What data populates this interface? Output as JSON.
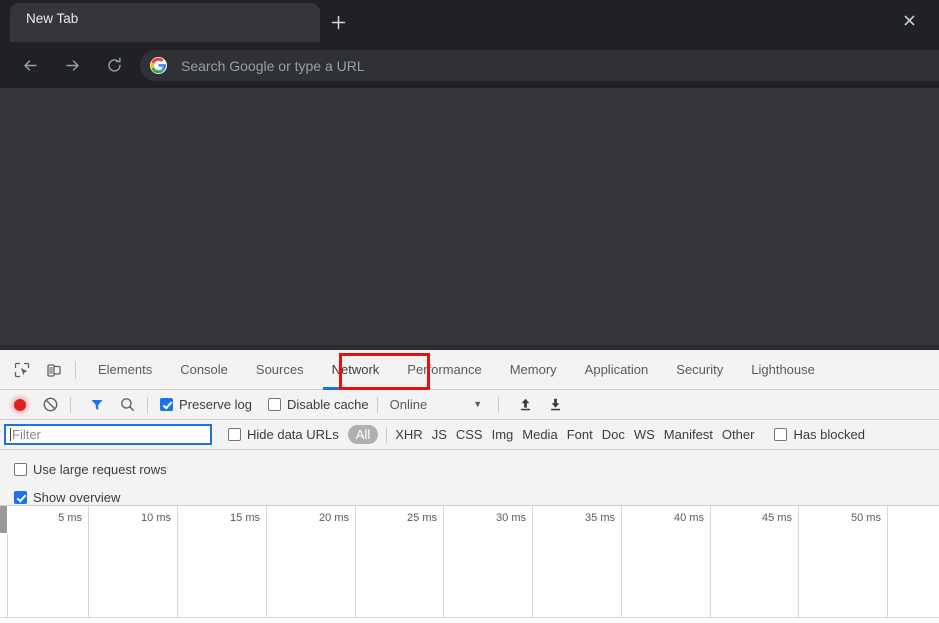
{
  "browser": {
    "tab": {
      "title": "New Tab",
      "close_icon": "close-icon"
    },
    "new_tab_button": "+",
    "nav": {
      "back_icon": "back-arrow-icon",
      "forward_icon": "forward-arrow-icon",
      "reload_icon": "reload-icon"
    },
    "omnibox": {
      "placeholder": "Search Google or type a URL",
      "value": "",
      "icon": "google-logo-icon"
    }
  },
  "devtools": {
    "inspect_icon": "inspect-element-icon",
    "device_icon": "device-toolbar-icon",
    "tabs": [
      {
        "label": "Elements",
        "active": false
      },
      {
        "label": "Console",
        "active": false
      },
      {
        "label": "Sources",
        "active": false
      },
      {
        "label": "Network",
        "active": true
      },
      {
        "label": "Performance",
        "active": false
      },
      {
        "label": "Memory",
        "active": false
      },
      {
        "label": "Application",
        "active": false
      },
      {
        "label": "Security",
        "active": false
      },
      {
        "label": "Lighthouse",
        "active": false
      }
    ],
    "annotation": {
      "target": "Network",
      "color": "#e3110f"
    },
    "toolbar": {
      "record_icon": "record-icon",
      "clear_icon": "clear-icon",
      "filter_icon": "filter-funnel-icon",
      "search_icon": "search-icon",
      "preserve_log": {
        "label": "Preserve log",
        "checked": true
      },
      "disable_cache": {
        "label": "Disable cache",
        "checked": false
      },
      "throttle": {
        "value": "Online",
        "caret": "▼"
      },
      "import_icon": "import-har-icon",
      "export_icon": "export-har-icon"
    },
    "filterbar": {
      "filter_input": {
        "placeholder": "Filter",
        "value": ""
      },
      "hide_data_urls": {
        "label": "Hide data URLs",
        "checked": false
      },
      "types": [
        {
          "label": "All",
          "selected": true
        },
        {
          "label": "XHR",
          "selected": false
        },
        {
          "label": "JS",
          "selected": false
        },
        {
          "label": "CSS",
          "selected": false
        },
        {
          "label": "Img",
          "selected": false
        },
        {
          "label": "Media",
          "selected": false
        },
        {
          "label": "Font",
          "selected": false
        },
        {
          "label": "Doc",
          "selected": false
        },
        {
          "label": "WS",
          "selected": false
        },
        {
          "label": "Manifest",
          "selected": false
        },
        {
          "label": "Other",
          "selected": false
        }
      ],
      "has_blocked": {
        "label": "Has blocked",
        "checked": false
      }
    },
    "options": {
      "use_large_request_rows": {
        "label": "Use large request rows",
        "checked": false
      },
      "show_overview": {
        "label": "Show overview",
        "checked": true
      }
    },
    "overview": {
      "ticks": [
        "5 ms",
        "10 ms",
        "15 ms",
        "20 ms",
        "25 ms",
        "30 ms",
        "35 ms",
        "40 ms",
        "45 ms",
        "50 ms"
      ],
      "empty": true
    }
  },
  "colors": {
    "chrome_dark": "#202124",
    "viewport": "#35363a",
    "devtools_bg": "#f3f3f3",
    "accent_blue": "#1a73e8",
    "annotation_red": "#e3110f",
    "record_red": "#e12020"
  }
}
